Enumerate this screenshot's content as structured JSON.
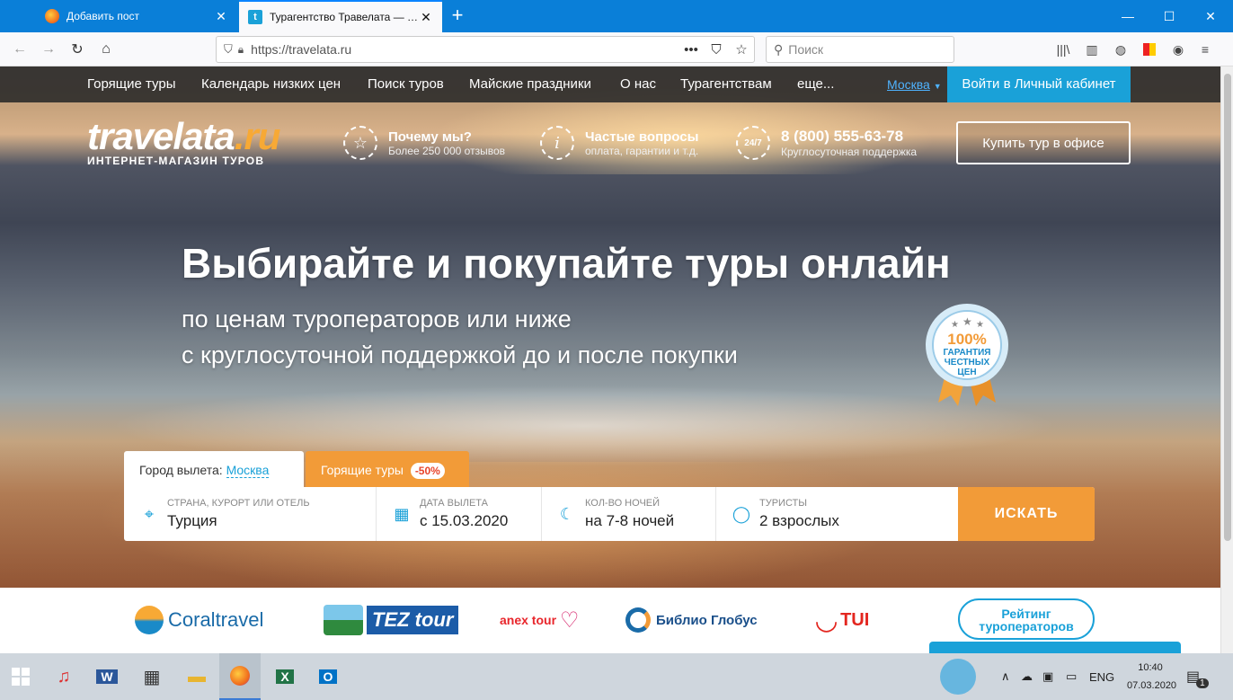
{
  "browser": {
    "tabs": [
      {
        "label": "Добавить пост",
        "active": false
      },
      {
        "label": "Турагентство Травелата — в Москве",
        "active": true
      }
    ],
    "url": "https://travelata.ru",
    "search_placeholder": "Поиск"
  },
  "site": {
    "nav": [
      "Горящие туры",
      "Календарь низких цен",
      "Поиск туров",
      "Майские праздники",
      "О нас",
      "Турагентствам",
      "еще..."
    ],
    "city": "Москва",
    "cabinet_label": "Войти в Личный кабинет",
    "logo_main": "travelata",
    "logo_ru": ".ru",
    "logo_tagline": "ИНТЕРНЕТ-МАГАЗИН ТУРОВ",
    "features": [
      {
        "icon": "star-icon",
        "title": "Почему мы?",
        "subtitle": "Более 250 000 отзывов"
      },
      {
        "icon": "info-icon",
        "title": "Частые вопросы",
        "subtitle": "оплата, гарантии и т.д."
      },
      {
        "icon": "clock-24-icon",
        "title": "8 (800) 555-63-78",
        "subtitle": "Круглосуточная поддержка"
      }
    ],
    "office_button": "Купить тур в офисе",
    "headline": "Выбирайте и покупайте туры онлайн",
    "subline1": "по ценам туроператоров или ниже",
    "subline2": "с круглосуточной поддержкой до и после покупки",
    "badge": {
      "percent": "100%",
      "line1": "ГАРАНТИЯ",
      "line2": "ЧЕСТНЫХ",
      "line3": "ЦЕН"
    },
    "search": {
      "departure_label": "Город вылета:",
      "departure_city": "Москва",
      "hot_tab_label": "Горящие туры",
      "hot_discount": "-50%",
      "fields": [
        {
          "label": "Страна, курорт или отель",
          "value": "Турция",
          "icon": "location-pin-icon"
        },
        {
          "label": "Дата вылета",
          "value": "с 15.03.2020",
          "icon": "calendar-icon"
        },
        {
          "label": "Кол-во ночей",
          "value": "на 7-8 ночей",
          "icon": "moon-icon"
        },
        {
          "label": "Туристы",
          "value": "2 взрослых",
          "icon": "user-icon"
        }
      ],
      "button": "ИСКАТЬ"
    },
    "partners": [
      "Coraltravel",
      "TEZ tour",
      "anex tour",
      "Библио Глобус",
      "TUI"
    ],
    "rating_button": "Рейтинг туроператоров"
  },
  "taskbar": {
    "lang": "ENG",
    "time": "10:40",
    "date": "07.03.2020",
    "notifications": "1"
  },
  "colors": {
    "accent": "#1aa1d8",
    "orange": "#f29b38",
    "titlebar": "#0a7fd8"
  }
}
